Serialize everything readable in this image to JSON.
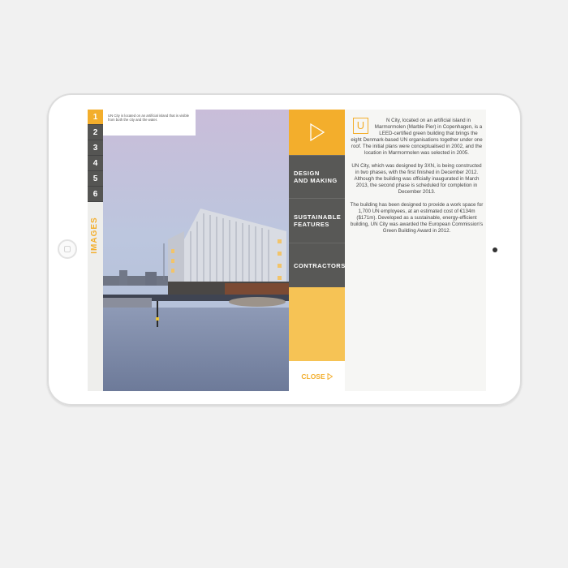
{
  "caption": "UN City is located on an artificial island that is visible from both the city and the water.",
  "images": {
    "numbers": [
      "1",
      "2",
      "3",
      "4",
      "5",
      "6"
    ],
    "active_index": 0,
    "label": "IMAGES"
  },
  "menu": {
    "items": [
      {
        "line1": "DESIGN",
        "line2": "AND MAKING"
      },
      {
        "line1": "SUSTAINABLE",
        "line2": "FEATURES"
      },
      {
        "line1": "CONTRACTORS",
        "line2": ""
      }
    ],
    "close_label": "CLOSE"
  },
  "article": {
    "dropcap": "U",
    "p1": "N City, located on an artificial island in Marmormolen (Marble Pier) in Copenhagen, is a LEED-certified green building that brings the eight Denmark-based UN organisations together under one roof. The initial plans were conceptualised in 2002, and the location in Marmormolen was selected in 2005.",
    "p2": "UN City, which was designed by 3XN, is being constructed in two phases, with the first finished in December 2012. Although the building was officially inaugurated in March 2013, the second phase is scheduled for completion in December 2013.",
    "p3": "The building has been designed to provide a work space for 1,700 UN employees, at an estimated cost of €134m ($171m). Developed as a sustainable, energy-efficient building, UN City was awarded the European Commission's Green Building Award in 2012."
  },
  "colors": {
    "accent": "#f3ae2c",
    "accent_light": "#f6c355",
    "menu_dark": "#585856"
  }
}
